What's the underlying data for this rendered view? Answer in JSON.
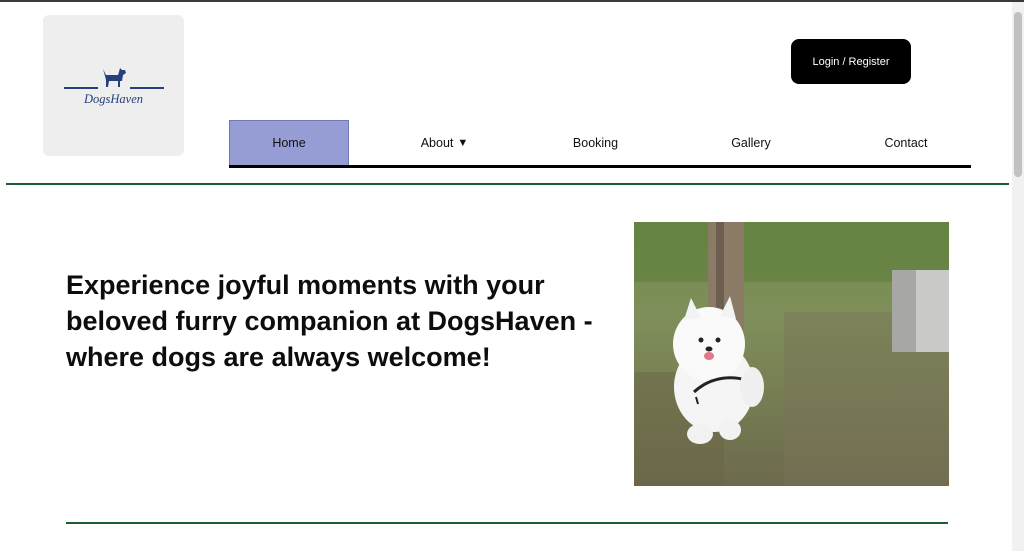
{
  "brand": {
    "name": "DogsHaven"
  },
  "header": {
    "login_label": "Login / Register"
  },
  "nav": {
    "items": [
      {
        "label": "Home",
        "active": true
      },
      {
        "label": "About",
        "has_dropdown": true,
        "caret": "▼"
      },
      {
        "label": "Booking"
      },
      {
        "label": "Gallery"
      },
      {
        "label": "Contact"
      }
    ]
  },
  "hero": {
    "headline": "Experience joyful moments with your beloved furry companion at DogsHaven - where dogs are always welcome!",
    "image_icon": "white-samoyed-dog-photo"
  },
  "colors": {
    "brand_blue": "#24407d",
    "nav_active_bg": "#959dd4",
    "divider_green": "#1c5c34",
    "button_bg": "#000000"
  }
}
